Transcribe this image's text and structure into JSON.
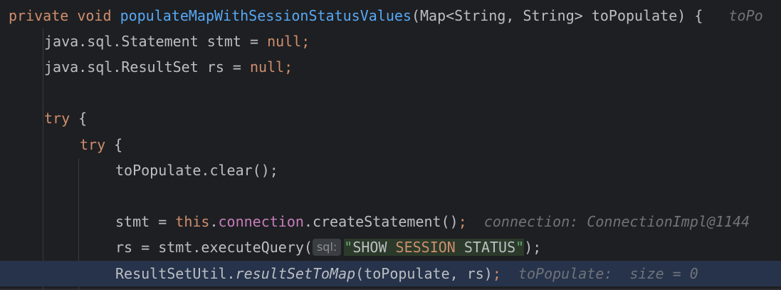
{
  "code": {
    "line1": {
      "kw_private": "private",
      "kw_void": "void",
      "method_name": "populateMapWithSessionStatusValues",
      "params": "(Map<String, String> toPopulate) {",
      "inline_hint": "toPo"
    },
    "line2": {
      "type": "java.sql.Statement stmt = ",
      "null_kw": "null",
      "semicolon": ";"
    },
    "line3": {
      "type": "java.sql.ResultSet rs = ",
      "null_kw": "null",
      "semicolon": ";"
    },
    "line5": {
      "kw_try": "try",
      "brace": " {"
    },
    "line6": {
      "kw_try": "try",
      "brace": " {"
    },
    "line7": {
      "text": "toPopulate.clear();"
    },
    "line9": {
      "prefix": "stmt = ",
      "kw_this": "this",
      "dot": ".",
      "field_connection": "connection",
      "call": ".createStatement()",
      "semicolon": ";",
      "debug_hint": "connection: ConnectionImpl@1144"
    },
    "line10": {
      "prefix": "rs = stmt.executeQuery(",
      "param_hint": "sql:",
      "quote_open": "\"",
      "sql_show": "SHOW",
      "sql_session": "SESSION",
      "sql_status": "STATUS",
      "quote_close": "\"",
      "suffix": ");"
    },
    "line11": {
      "class_name": "ResultSetUtil.",
      "static_method": "resultSetToMap",
      "args": "(toPopulate, rs)",
      "semicolon": ";",
      "debug_hint": "toPopulate:  size = 0"
    }
  },
  "colors": {
    "background": "#1e1f22",
    "current_line": "#26334a",
    "keyword": "#cf8e6d",
    "method": "#56a8f5",
    "field": "#c77dbb",
    "hint": "#6f737a"
  }
}
